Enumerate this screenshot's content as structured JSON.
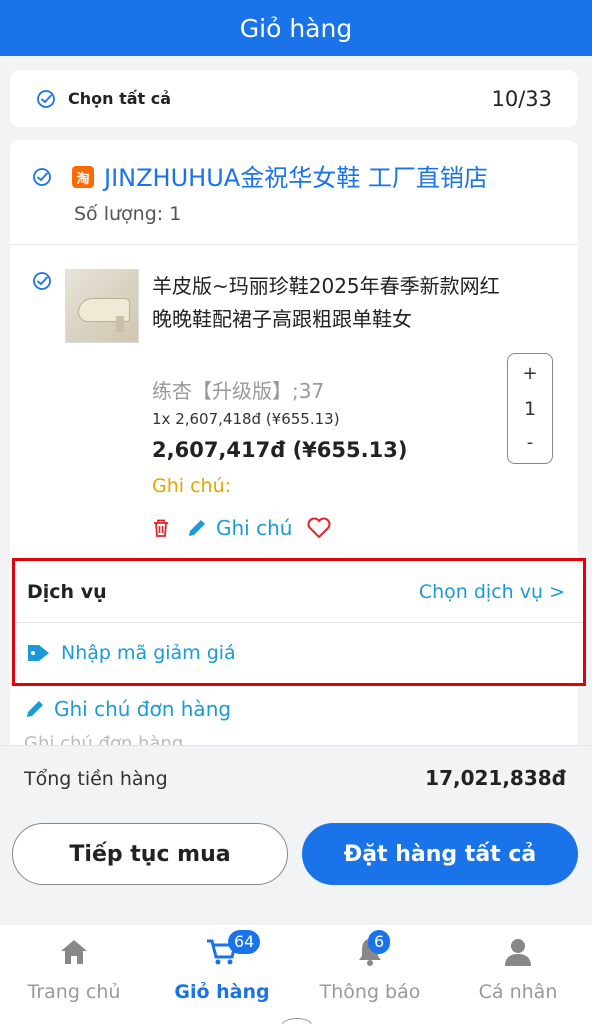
{
  "header": {
    "title": "Giỏ hàng"
  },
  "select_all": {
    "label": "Chọn tất cả",
    "count": "10/33"
  },
  "shop": {
    "logo_text": "淘",
    "name": "JINZHUHUA金祝华女鞋 工厂直销店",
    "quantity": "Số lượng: 1",
    "item": {
      "title": "羊皮版~玛丽珍鞋2025年春季新款网红晚晚鞋配裙子高跟粗跟单鞋女",
      "variant": "练杏【升级版】;37",
      "unit_price": "1x 2,607,418đ (¥655.13)",
      "total_price": "2,607,417đ (¥655.13)",
      "note_label": "Ghi chú:",
      "stepper": {
        "plus": "+",
        "value": "1",
        "minus": "-"
      },
      "actions": {
        "note": "Ghi chú"
      }
    }
  },
  "service": {
    "title": "Dịch vụ",
    "choose": "Chọn dịch vụ >",
    "coupon": "Nhập mã giảm giá"
  },
  "order_note": {
    "label": "Ghi chú đơn hàng",
    "placeholder": "Ghi chú đơn hàng"
  },
  "summary": {
    "label": "Tổng tiền hàng",
    "value": "17,021,838đ"
  },
  "buttons": {
    "continue": "Tiếp tục mua",
    "order_all": "Đặt hàng tất cả"
  },
  "tabs": [
    {
      "label": "Trang chủ",
      "icon": "home-icon"
    },
    {
      "label": "Giỏ hàng",
      "icon": "cart-icon",
      "badge": "64"
    },
    {
      "label": "Thông báo",
      "icon": "bell-icon",
      "badge": "6"
    },
    {
      "label": "Cá nhân",
      "icon": "user-icon"
    }
  ],
  "colors": {
    "primary": "#1a73e8",
    "link": "#1a9ad6",
    "highlight": "#e3000b",
    "note": "#e0a800"
  }
}
